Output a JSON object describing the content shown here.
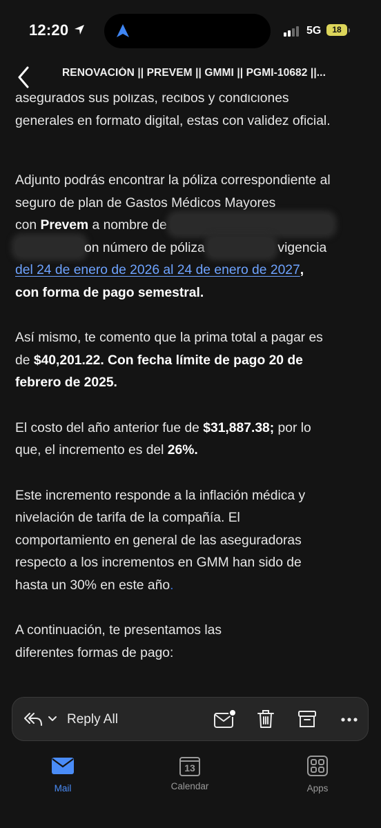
{
  "status_bar": {
    "time": "12:20",
    "network": "5G",
    "battery_level": "18"
  },
  "header": {
    "subject": "RENOVACIÓN || PREVEM || GMMI || PGMI-10682 ||..."
  },
  "email": {
    "p0_line1": "asegurados sus pólizas, recibos y condiciones",
    "p0_line2": "generales en formato digital, estas con validez oficial.",
    "p1_line1": "Adjunto podrás encontrar la póliza correspondiente al",
    "p1_line2": "seguro de plan de Gastos Médicos Mayores",
    "p1_con": "con ",
    "p1_prevem": "Prevem",
    "p1_nombre": " a nombre de ",
    "p1_numero": "on número de póliza ",
    "p1_vigencia": " vigencia",
    "p1_link": "del 24 de enero de 2026 al 24 de enero de 2027",
    "p1_comma": ",",
    "p1_forma": "con forma de pago semestral.",
    "p2_line1": "Así mismo, te comento que la prima total a pagar es",
    "p2_de": "de ",
    "p2_amount": "$40,201.22. Con fecha límite  de pago 20 de",
    "p2_date_end": "febrero de 2025.",
    "p3_text1": "El costo del año anterior fue de ",
    "p3_amount": "$31,887.38;",
    "p3_text2": " por lo",
    "p3_text3": "que, el incremento es del ",
    "p3_pct": "26%.",
    "p4_line1": "Este incremento responde a la inflación médica y",
    "p4_line2": "nivelación de tarifa de la compañía. El",
    "p4_line3": "comportamiento en general de las aseguradoras",
    "p4_line4": "respecto a los incrementos en GMM han sido de",
    "p4_line5": "hasta un 30% en este año",
    "p4_dot": ".",
    "p5_line1": "A continuación, te presentamos las",
    "p5_line2": "diferentes formas de pago:"
  },
  "action_bar": {
    "reply_all_label": "Reply All"
  },
  "tab_bar": {
    "mail_label": "Mail",
    "calendar_label": "Calendar",
    "calendar_day": "13",
    "apps_label": "Apps"
  },
  "colors": {
    "background": "#141414",
    "accent": "#4a8cf7",
    "link": "#6ea3ff",
    "battery": "#dcd55a"
  },
  "icons": [
    "location-arrow-icon",
    "navigation-arrow-icon",
    "cellular-signal-icon",
    "battery-icon",
    "back-chevron-icon",
    "reply-all-icon",
    "chevron-down-icon",
    "mark-unread-icon",
    "trash-icon",
    "archive-icon",
    "more-icon",
    "mail-icon",
    "calendar-icon",
    "apps-icon"
  ]
}
